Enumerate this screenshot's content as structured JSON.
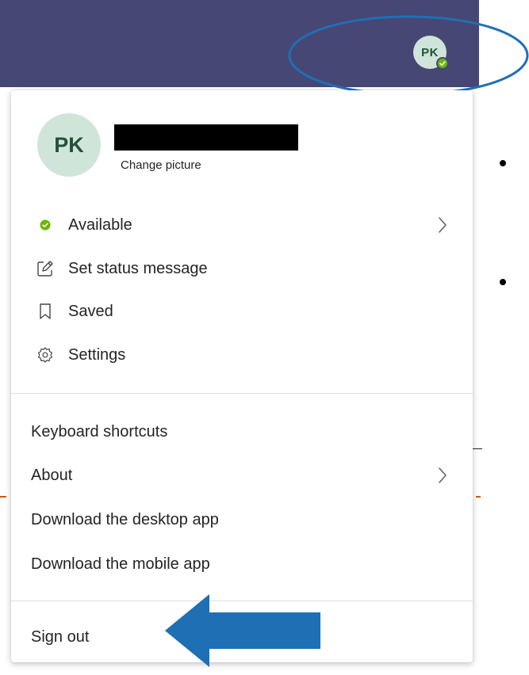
{
  "header": {
    "avatar_initials": "PK"
  },
  "profile": {
    "initials": "PK",
    "change_picture_label": "Change picture"
  },
  "status_section": {
    "items": [
      {
        "label": "Available",
        "icon": "presence-available-icon"
      },
      {
        "label": "Set status message",
        "icon": "edit-status-icon"
      },
      {
        "label": "Saved",
        "icon": "bookmark-icon"
      },
      {
        "label": "Settings",
        "icon": "gear-icon"
      }
    ]
  },
  "info_section": {
    "items": [
      {
        "label": "Keyboard shortcuts"
      },
      {
        "label": "About"
      },
      {
        "label": "Download the desktop app"
      },
      {
        "label": "Download the mobile app"
      }
    ]
  },
  "sign_out": {
    "label": "Sign out"
  },
  "colors": {
    "header_bg": "#464775",
    "avatar_bg": "#cfe5da",
    "avatar_text": "#235238",
    "presence_green": "#6bb700",
    "annotation_blue": "#1f6fb5"
  }
}
